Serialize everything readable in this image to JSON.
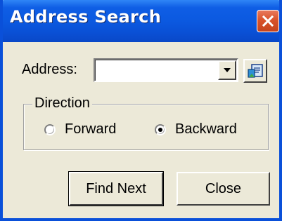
{
  "window": {
    "title": "Address Search"
  },
  "form": {
    "address_label": "Address:",
    "address_value": "",
    "address_placeholder": ""
  },
  "direction": {
    "legend": "Direction",
    "options": [
      {
        "label": "Forward",
        "selected": false
      },
      {
        "label": "Backward",
        "selected": true
      }
    ]
  },
  "buttons": {
    "find_next": "Find Next",
    "close": "Close"
  },
  "icons": {
    "title_close": "close-icon",
    "combo_arrow": "chevron-down-icon",
    "picker": "address-book-icon"
  },
  "colors": {
    "titlebar": "#0a59e0",
    "close_button": "#d9532b",
    "dialog_background": "#ece9d8"
  }
}
